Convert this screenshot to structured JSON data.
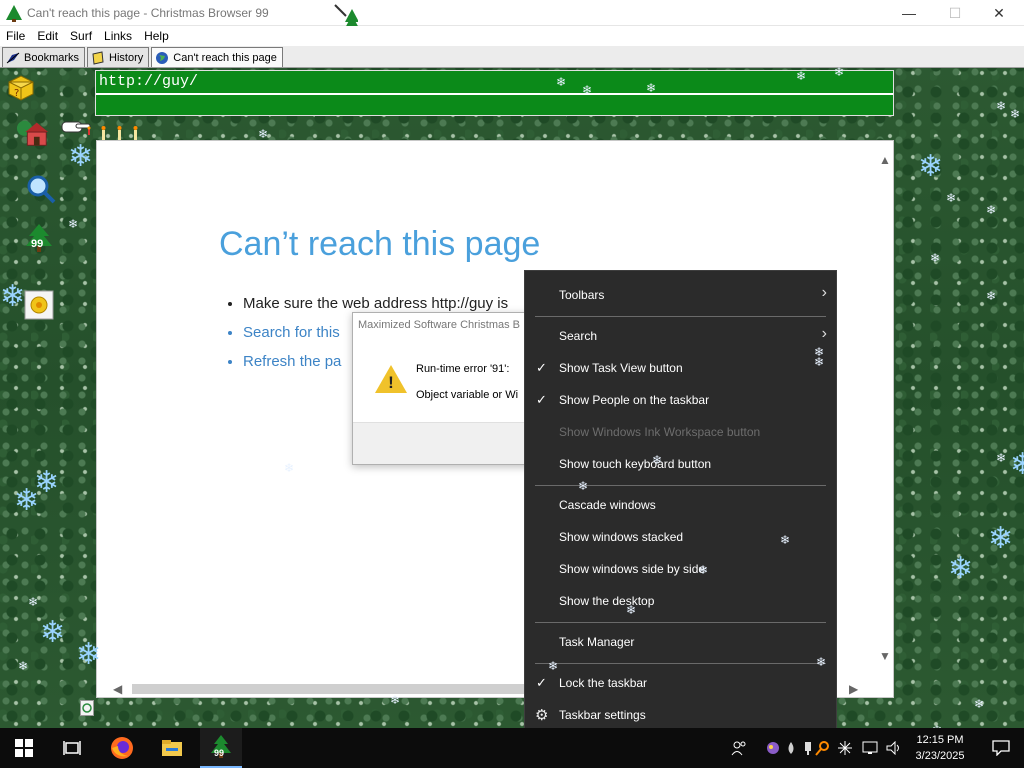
{
  "window": {
    "title": "Can't reach this page - Christmas Browser 99",
    "minimize": "—",
    "maximize": "☐",
    "close": "✕"
  },
  "menu": [
    "File",
    "Edit",
    "Surf",
    "Links",
    "Help"
  ],
  "tabs": [
    {
      "label": "Bookmarks",
      "icon": "bookmarks-icon"
    },
    {
      "label": "History",
      "icon": "history-icon"
    },
    {
      "label": "Can't reach this page",
      "icon": "globe-icon"
    }
  ],
  "sidebar": {
    "badge_99": "99"
  },
  "address": {
    "url": "http://guy/",
    "second_line": ""
  },
  "page": {
    "title": "Can’t reach this page",
    "bullets": [
      "Make sure the web address http://guy is",
      "Search for this",
      "Refresh the pa"
    ]
  },
  "dialog": {
    "title": "Maximized Software Christmas B",
    "line1": "Run-time error '91':",
    "line2": "Object variable or Wi"
  },
  "context_menu": {
    "items": [
      {
        "label": "Toolbars",
        "submenu": true
      },
      {
        "label": "Search",
        "submenu": true
      },
      {
        "label": "Show Task View button",
        "checked": true
      },
      {
        "label": "Show People on the taskbar",
        "checked": true
      },
      {
        "label": "Show Windows Ink Workspace button",
        "disabled": true
      },
      {
        "label": "Show touch keyboard button"
      },
      {
        "label": "Cascade windows"
      },
      {
        "label": "Show windows stacked"
      },
      {
        "label": "Show windows side by side"
      },
      {
        "label": "Show the desktop"
      },
      {
        "label": "Task Manager"
      },
      {
        "label": "Lock the taskbar",
        "checked": true
      },
      {
        "label": "Taskbar settings"
      }
    ],
    "check_glyph": "✓",
    "chevron_glyph": "›",
    "gear_glyph": "⚙"
  },
  "taskbar": {
    "time": "12:15 PM",
    "date": "3/23/2025",
    "app_badge": "99"
  },
  "colors": {
    "address_bg": "#0b8a19",
    "page_title": "#4aa0dc",
    "link": "#3d84c6",
    "menu_bg": "#2b2b2b",
    "taskbar_bg": "#0c0c0c"
  }
}
